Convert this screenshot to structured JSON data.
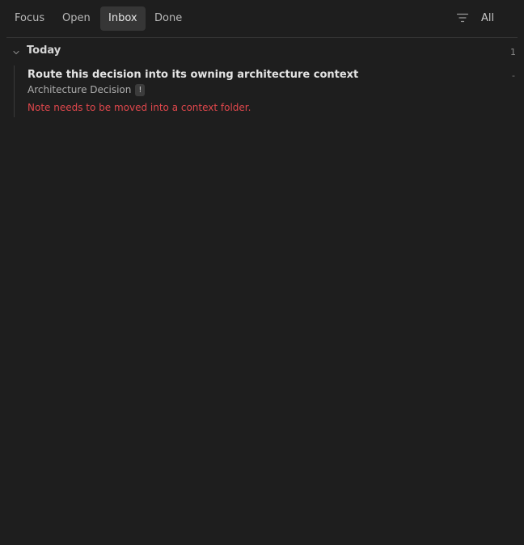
{
  "tabs": [
    {
      "label": "Focus"
    },
    {
      "label": "Open"
    },
    {
      "label": "Inbox",
      "active": true
    },
    {
      "label": "Done"
    }
  ],
  "filter": {
    "icon": "filter-icon",
    "label": "All"
  },
  "groups": [
    {
      "title": "Today",
      "count": "1",
      "icon": "chevron-down-icon",
      "items": [
        {
          "title": "Route this decision into its owning architecture context",
          "meta": "-",
          "type": "Architecture Decision",
          "badge": "!",
          "note": "Note needs to be moved into a context folder."
        }
      ]
    }
  ],
  "colors": {
    "background": "#1e1e1e",
    "active_tab": "#363636",
    "error_text": "#e0474c"
  }
}
